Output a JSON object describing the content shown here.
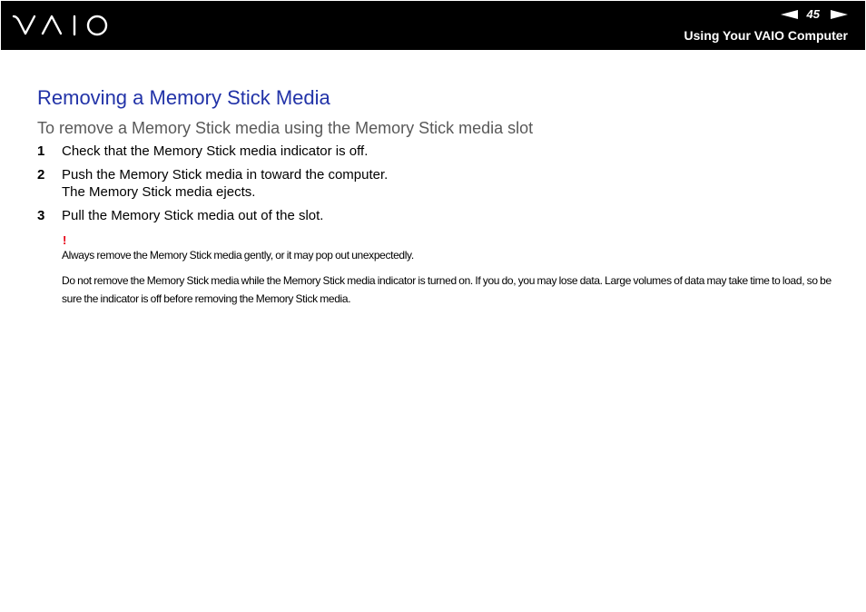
{
  "header": {
    "logo": "VAIO",
    "page_number": "45",
    "section_title": "Using Your VAIO Computer",
    "icons": {
      "prev": "prev-page-arrow-icon",
      "next": "next-page-arrow-icon"
    }
  },
  "main": {
    "title": "Removing a Memory Stick Media",
    "subtitle": "To remove a Memory Stick media using the Memory Stick media slot",
    "steps": [
      {
        "num": "1",
        "line1": "Check that the Memory Stick media indicator is off."
      },
      {
        "num": "2",
        "line1": "Push the Memory Stick media in toward the computer.",
        "line2": "The Memory Stick media ejects."
      },
      {
        "num": "3",
        "line1": "Pull the Memory Stick media out of the slot."
      }
    ],
    "note": {
      "marker": "!",
      "paragraphs": [
        "Always remove the Memory Stick media gently, or it may pop out unexpectedly.",
        "Do not remove the Memory Stick media while the Memory Stick media indicator is turned on. If you do, you may lose data. Large volumes of data may take time to load, so be sure the indicator is off before removing the Memory Stick media."
      ]
    }
  },
  "colors": {
    "header_bg": "#000000",
    "title": "#2233a8",
    "subtitle": "#595959",
    "warning": "#e60012"
  }
}
